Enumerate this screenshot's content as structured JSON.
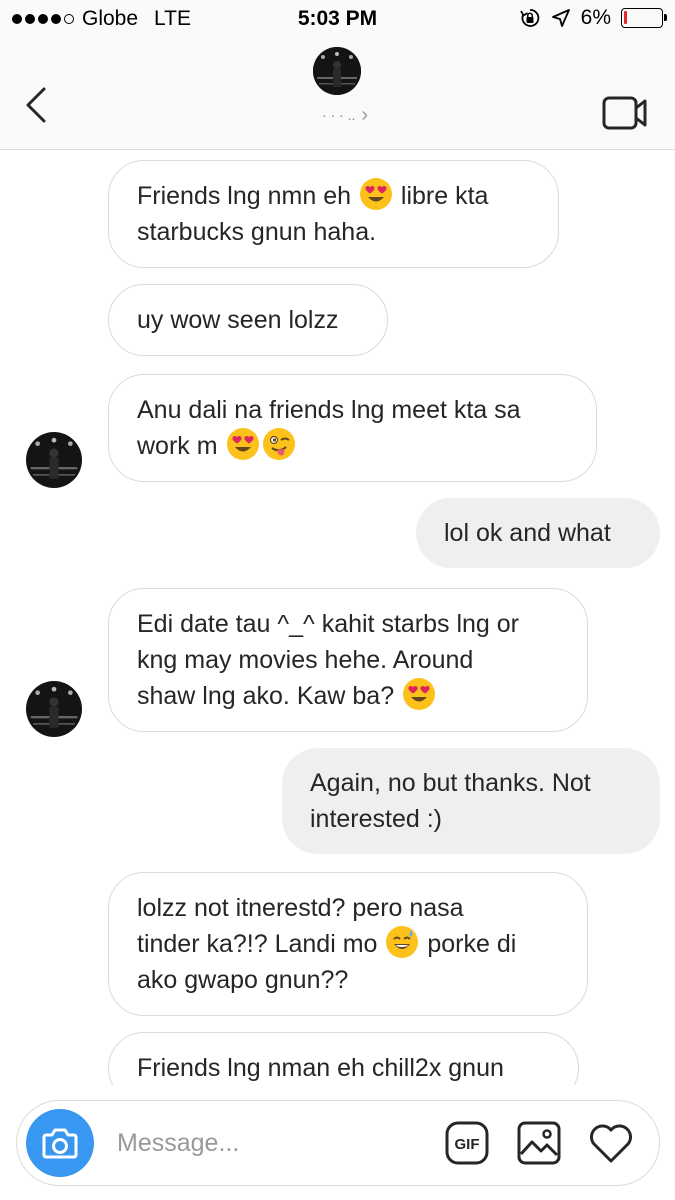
{
  "status": {
    "carrier": "Globe",
    "network": "LTE",
    "time": "5:03 PM",
    "battery_percent": "6%",
    "battery_level": 0.06,
    "battery_color": "#e8262a"
  },
  "header": {
    "name": "· · · ..",
    "chevron": "›",
    "back_icon": "chevron-left-icon",
    "video_icon": "video-camera-icon"
  },
  "messages": [
    {
      "side": "in",
      "parts": [
        "Friends lng nmn eh ",
        ":heart-eyes:",
        " libre kta",
        "\n",
        "starbucks gnun haha."
      ]
    },
    {
      "side": "in",
      "parts": [
        "uy wow seen lolzz"
      ]
    },
    {
      "side": "in",
      "avatar": true,
      "parts": [
        "Anu dali na friends lng meet kta sa",
        "\n",
        "work m ",
        ":heart-eyes:",
        ":wink-tongue:"
      ]
    },
    {
      "side": "out",
      "parts": [
        "lol ok and what"
      ]
    },
    {
      "side": "in",
      "avatar": true,
      "parts": [
        "Edi date tau ^_^ kahit starbs lng or",
        "\n",
        "kng may movies hehe. Around",
        "\n",
        "shaw lng ako. Kaw ba? ",
        ":heart-eyes:"
      ]
    },
    {
      "side": "out",
      "parts": [
        "Again, no but thanks. Not",
        "\n",
        "interested :)"
      ]
    },
    {
      "side": "in",
      "parts": [
        "lolzz not itnerestd? pero nasa",
        "\n",
        "tinder ka?!? Landi mo ",
        ":sweat-smile:",
        "  porke di",
        "\n",
        "ako gwapo gnun??"
      ]
    },
    {
      "side": "in",
      "parts": [
        "Friends lng nman eh chill2x gnun"
      ]
    }
  ],
  "composer": {
    "placeholder": "Message...",
    "camera_icon": "camera-icon",
    "gif_label": "GIF",
    "image_icon": "image-icon",
    "heart_icon": "heart-icon",
    "accent": "#3897f0"
  }
}
